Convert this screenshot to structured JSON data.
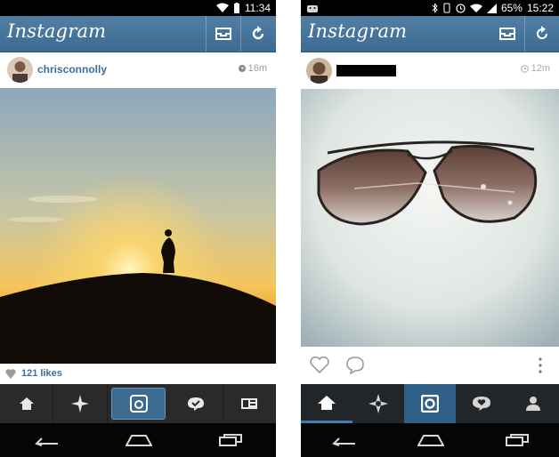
{
  "left": {
    "statusbar": {
      "time": "11:34"
    },
    "header": {
      "logo": "Instagram"
    },
    "post": {
      "username": "chrisconnolly",
      "time": "16m",
      "likes": "121 likes"
    }
  },
  "right": {
    "statusbar": {
      "battery": "65%",
      "time": "15:22"
    },
    "header": {
      "logo": "Instagram"
    },
    "post": {
      "username": "",
      "time": "12m"
    }
  },
  "icons": {
    "header": [
      "inbox-icon",
      "refresh-icon"
    ],
    "tabs_left": [
      "home-icon",
      "explore-icon",
      "camera-icon",
      "news-icon",
      "profile-icon"
    ],
    "tabs_right": [
      "home-icon",
      "explore-icon",
      "camera-icon",
      "news-icon",
      "profile-icon"
    ],
    "nav": [
      "back-icon",
      "home-nav-icon",
      "recents-icon"
    ]
  },
  "colors": {
    "header_blue": "#3f6d98",
    "tab_bar": "#2a2a2a",
    "active_tab_left": "#3c6b92",
    "active_tab_right": "#2f5f86"
  }
}
